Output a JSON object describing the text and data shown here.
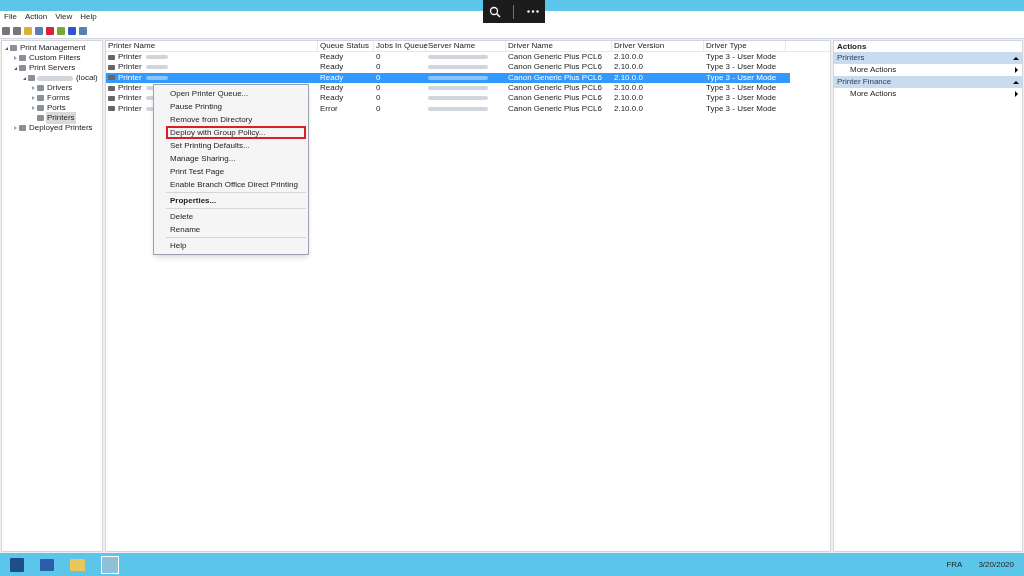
{
  "menu_bar": [
    "File",
    "Action",
    "View",
    "Help"
  ],
  "tree": [
    {
      "label": "Print Management",
      "expanded": true,
      "selected": false,
      "children": [
        {
          "label": "Custom Filters",
          "expanded": false,
          "selected": false
        },
        {
          "label": "Print Servers",
          "expanded": true,
          "selected": false,
          "children": [
            {
              "label": "(local)",
              "blurred": true,
              "expanded": true,
              "selected": false,
              "children": [
                {
                  "label": "Drivers",
                  "expanded": false,
                  "selected": false
                },
                {
                  "label": "Forms",
                  "expanded": false,
                  "selected": false
                },
                {
                  "label": "Ports",
                  "expanded": false,
                  "selected": false
                },
                {
                  "label": "Printers",
                  "selected": true
                }
              ]
            }
          ]
        },
        {
          "label": "Deployed Printers",
          "expanded": false,
          "selected": false
        }
      ]
    }
  ],
  "table": {
    "columns": [
      "Printer Name",
      "Queue Status",
      "Jobs In Queue",
      "Server Name",
      "Driver Name",
      "Driver Version",
      "Driver Type"
    ],
    "rows": [
      {
        "name": "Printer",
        "status": "Ready",
        "jobs": "0",
        "driver": "Canon Generic Plus PCL6",
        "version": "2.10.0.0",
        "type": "Type 3 - User Mode",
        "selected": false
      },
      {
        "name": "Printer",
        "status": "Ready",
        "jobs": "0",
        "driver": "Canon Generic Plus PCL6",
        "version": "2.10.0.0",
        "type": "Type 3 - User Mode",
        "selected": false
      },
      {
        "name": "Printer",
        "status": "Ready",
        "jobs": "0",
        "driver": "Canon Generic Plus PCL6",
        "version": "2.10.0.0",
        "type": "Type 3 - User Mode",
        "selected": true
      },
      {
        "name": "Printer",
        "status": "Ready",
        "jobs": "0",
        "driver": "Canon Generic Plus PCL6",
        "version": "2.10.0.0",
        "type": "Type 3 - User Mode",
        "selected": false
      },
      {
        "name": "Printer",
        "status": "Ready",
        "jobs": "0",
        "driver": "Canon Generic Plus PCL6",
        "version": "2.10.0.0",
        "type": "Type 3 - User Mode",
        "selected": false
      },
      {
        "name": "Printer",
        "status": "Error",
        "jobs": "0",
        "driver": "Canon Generic Plus PCL6",
        "version": "2.10.0.0",
        "type": "Type 3 - User Mode",
        "selected": false
      }
    ]
  },
  "context_menu": [
    {
      "items": [
        {
          "label": "Open Printer Queue...",
          "bold": false,
          "highlighted": false
        },
        {
          "label": "Pause Printing",
          "bold": false,
          "highlighted": false
        },
        {
          "label": "Remove from Directory",
          "bold": false,
          "highlighted": false
        },
        {
          "label": "Deploy with Group Policy...",
          "bold": false,
          "highlighted": true
        },
        {
          "label": "Set Printing Defaults...",
          "bold": false,
          "highlighted": false
        },
        {
          "label": "Manage Sharing...",
          "bold": false,
          "highlighted": false
        },
        {
          "label": "Print Test Page",
          "bold": false,
          "highlighted": false
        },
        {
          "label": "Enable Branch Office Direct Printing",
          "bold": false,
          "highlighted": false
        }
      ]
    },
    {
      "items": [
        {
          "label": "Properties...",
          "bold": true,
          "highlighted": false
        }
      ]
    },
    {
      "items": [
        {
          "label": "Delete",
          "bold": false,
          "highlighted": false
        },
        {
          "label": "Rename",
          "bold": false,
          "highlighted": false
        }
      ]
    },
    {
      "items": [
        {
          "label": "Help",
          "bold": false,
          "highlighted": false
        }
      ]
    }
  ],
  "actions": {
    "title": "Actions",
    "sections": [
      {
        "title": "Printers",
        "items": [
          "More Actions"
        ]
      },
      {
        "title": "Printer Finance",
        "items": [
          "More Actions"
        ]
      }
    ]
  },
  "taskbar": {
    "language": "FRA",
    "date": "3/20/2020"
  }
}
